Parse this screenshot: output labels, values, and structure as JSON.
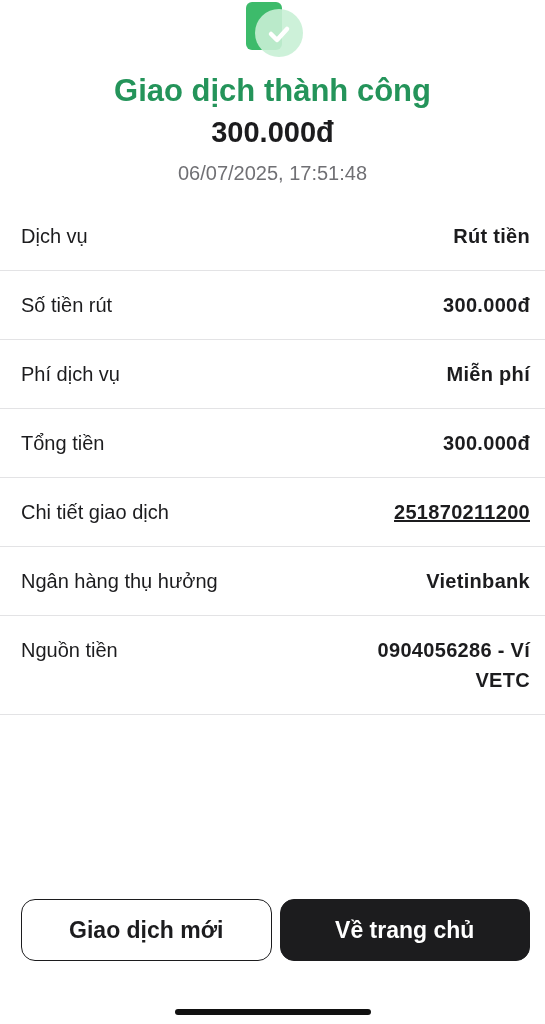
{
  "status": {
    "title": "Giao dịch thành công",
    "amount": "300.000đ",
    "datetime": "06/07/2025, 17:51:48"
  },
  "details": [
    {
      "label": "Dịch vụ",
      "value": "Rút tiền",
      "kind": "text"
    },
    {
      "label": "Số tiền rút",
      "value": "300.000đ",
      "kind": "text"
    },
    {
      "label": "Phí dịch vụ",
      "value": "Miễn phí",
      "kind": "text"
    },
    {
      "label": "Tổng tiền",
      "value": "300.000đ",
      "kind": "text"
    },
    {
      "label": "Chi tiết giao dịch",
      "value": "251870211200",
      "kind": "link"
    },
    {
      "label": "Ngân hàng thụ hưởng",
      "value": "Vietinbank",
      "kind": "text"
    },
    {
      "label": "Nguồn tiền",
      "value": "0904056286 - Ví VETC",
      "kind": "text"
    }
  ],
  "buttons": [
    {
      "label": "Giao dịch mới",
      "kind": "outline"
    },
    {
      "label": "Về trang chủ",
      "kind": "filled"
    }
  ]
}
